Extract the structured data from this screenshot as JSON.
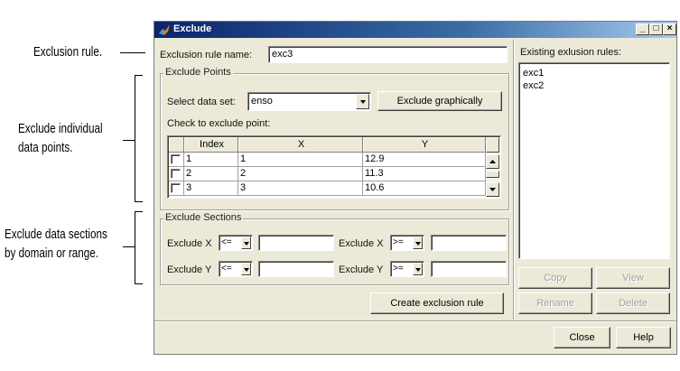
{
  "annotations": {
    "exclusion_rule": "Exclusion rule.",
    "individual_line1": "Exclude individual",
    "individual_line2": "data points.",
    "sections_line1": "Exclude data sections",
    "sections_line2": "by domain or range."
  },
  "window": {
    "title": "Exclude",
    "minimize": "_",
    "maximize": "□",
    "close": "×"
  },
  "rule_name": {
    "label": "Exclusion rule name:",
    "value": "exc3"
  },
  "exclude_points": {
    "legend": "Exclude Points",
    "select_label": "Select data set:",
    "dataset": "enso",
    "graphic_button": "Exclude graphically",
    "check_label": "Check to exclude point:",
    "columns": [
      "Index",
      "X",
      "Y"
    ],
    "rows": [
      {
        "index": "1",
        "x": "1",
        "y": "12.9"
      },
      {
        "index": "2",
        "x": "2",
        "y": "11.3"
      },
      {
        "index": "3",
        "x": "3",
        "y": "10.6"
      }
    ]
  },
  "exclude_sections": {
    "legend": "Exclude Sections",
    "x_label": "Exclude X",
    "y_label": "Exclude Y",
    "x_low_op": "<=",
    "x_high_op": ">=",
    "y_low_op": "<=",
    "y_high_op": ">=",
    "x_low_value": "",
    "x_high_value": "",
    "y_low_value": "",
    "y_high_value": ""
  },
  "create_button": "Create exclusion rule",
  "existing": {
    "label": "Existing exlusion rules:",
    "items": [
      "exc1",
      "exc2"
    ]
  },
  "actions": {
    "copy": "Copy",
    "view": "View",
    "rename": "Rename",
    "delete": "Delete"
  },
  "footer": {
    "close": "Close",
    "help": "Help"
  }
}
